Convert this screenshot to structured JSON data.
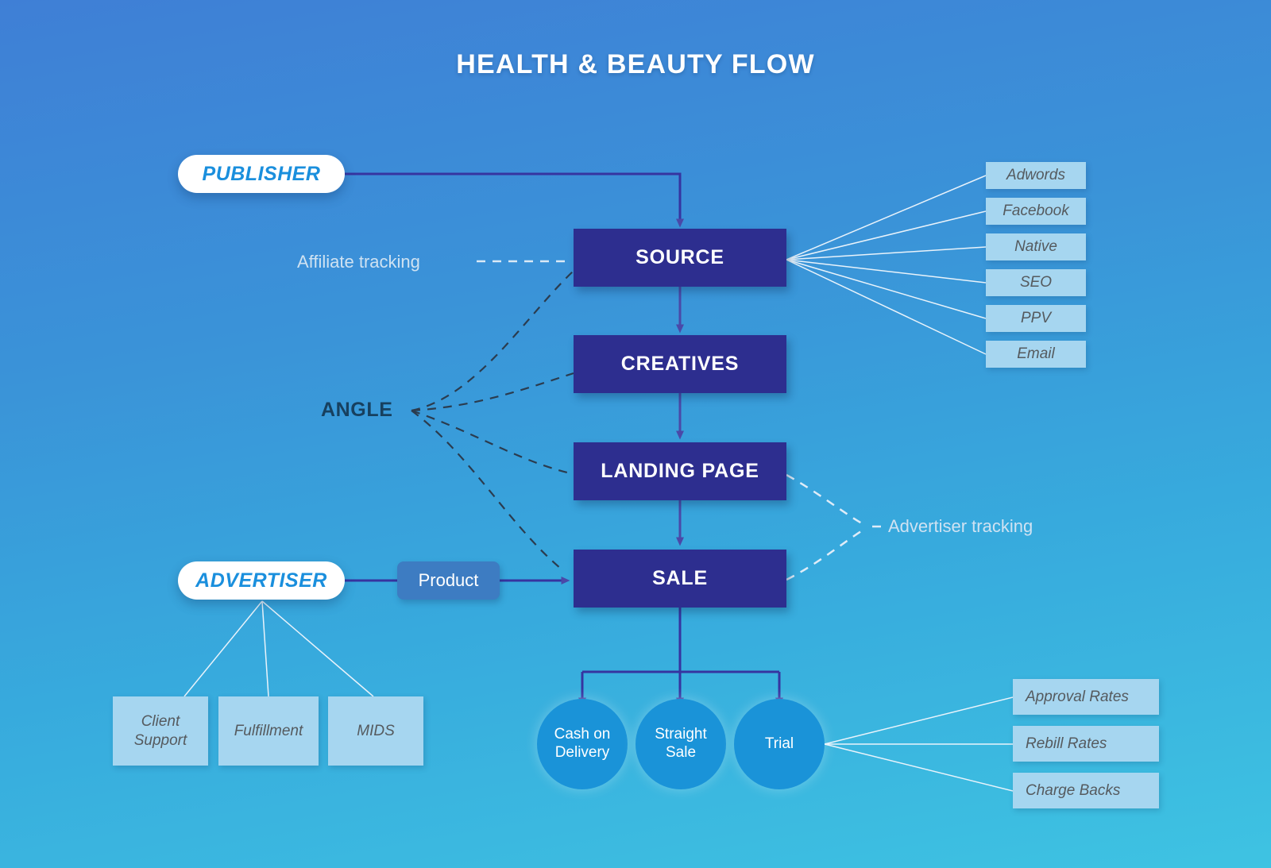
{
  "title": "HEALTH & BEAUTY FLOW",
  "colors": {
    "bg_top": "#3f7fd6",
    "bg_bottom": "#3ec3e2",
    "node_fill": "#2d2e8f",
    "tag_fill": "#a6d6f0",
    "chip_fill": "#3d7cc2",
    "circle_fill": "#1a93d8",
    "pill_text": "#1a8fdd",
    "arrow": "#4a49a8",
    "dashed_dark": "#2a3b4d",
    "dashed_light": "#d8e8f5",
    "thin_line": "#e8f2fa"
  },
  "actors": {
    "publisher": "PUBLISHER",
    "advertiser": "ADVERTISER"
  },
  "flow": {
    "source": "SOURCE",
    "creatives": "CREATIVES",
    "landing_page": "LANDING PAGE",
    "sale": "SALE"
  },
  "labels": {
    "affiliate_tracking": "Affiliate tracking",
    "advertiser_tracking": "Advertiser tracking",
    "angle": "ANGLE",
    "product": "Product"
  },
  "traffic_sources": [
    "Adwords",
    "Facebook",
    "Native",
    "SEO",
    "PPV",
    "Email"
  ],
  "advertiser_functions": [
    "Client Support",
    "Fulfillment",
    "MIDS"
  ],
  "advertiser_functions_lines": [
    [
      "Client",
      "Support"
    ],
    [
      "Fulfillment"
    ],
    [
      "MIDS"
    ]
  ],
  "sale_types": [
    [
      "Cash on",
      "Delivery"
    ],
    [
      "Straight",
      "Sale"
    ],
    [
      "Trial"
    ]
  ],
  "trial_metrics": [
    "Approval Rates",
    "Rebill Rates",
    "Charge Backs"
  ]
}
